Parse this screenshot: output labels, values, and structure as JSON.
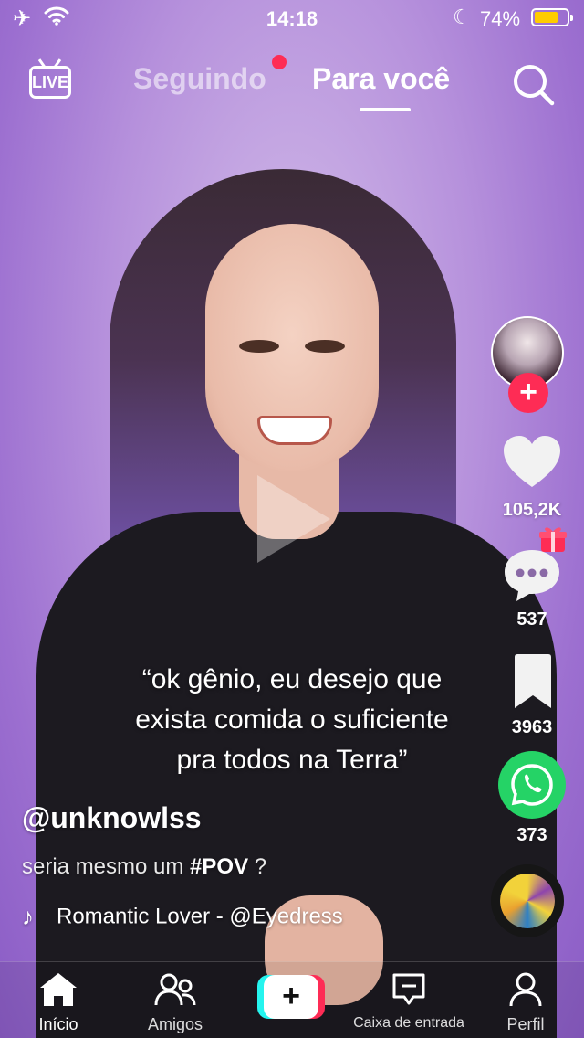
{
  "status_bar": {
    "time": "14:18",
    "battery_percent": "74%",
    "icons": [
      "airplane-icon",
      "wifi-icon",
      "moon-icon",
      "battery-icon"
    ],
    "battery_level": 0.74
  },
  "top_nav": {
    "live_label": "LIVE",
    "tab_following": "Seguindo",
    "tab_for_you": "Para você",
    "active_tab": "Para você",
    "search_icon": "search-icon"
  },
  "video": {
    "caption_lines": [
      "“ok gênio, eu desejo que",
      "exista comida o suficiente",
      "pra todos na Terra”"
    ],
    "state": "paused"
  },
  "right_rail": {
    "like_count": "105,2K",
    "comment_count": "537",
    "save_count": "3963",
    "share_count": "373",
    "follow_symbol": "+"
  },
  "post": {
    "username": "@unknowlss",
    "description_text": "seria mesmo um ",
    "hashtag": "#POV",
    "description_suffix": " ?",
    "sound": "Romantic Lover - @Eyedress"
  },
  "tab_bar": {
    "home": "Início",
    "friends": "Amigos",
    "create_symbol": "+",
    "inbox": "Caixa de entrada",
    "profile": "Perfil"
  },
  "colors": {
    "accent_red": "#fe2c55",
    "accent_cyan": "#25f4ee",
    "whatsapp_green": "#25d366",
    "battery_yellow": "#ffcc00"
  }
}
